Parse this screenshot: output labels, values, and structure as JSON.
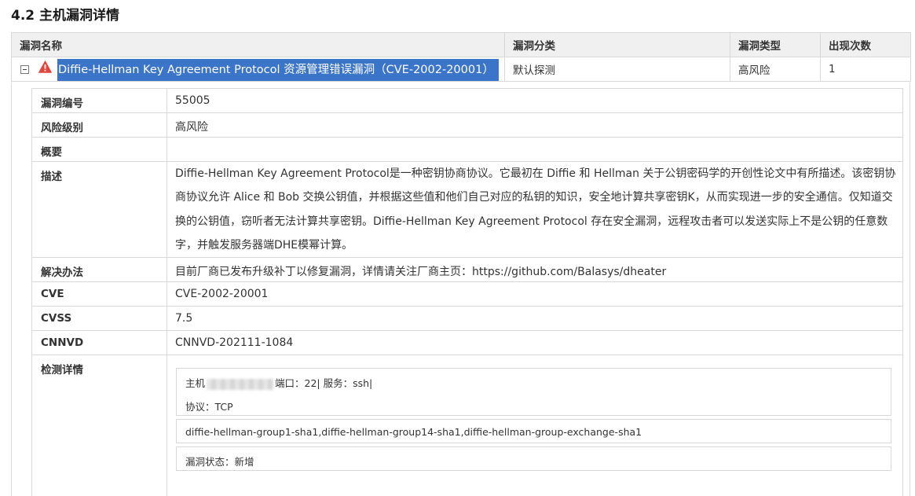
{
  "section_title": "4.2 主机漏洞详情",
  "table": {
    "headers": [
      "漏洞名称",
      "漏洞分类",
      "漏洞类型",
      "出现次数"
    ],
    "row": {
      "name": "Diffie-Hellman Key Agreement Protocol 资源管理错误漏洞（CVE-2002-20001）",
      "category": "默认探测",
      "type": "高风险",
      "count": "1"
    }
  },
  "details": {
    "id_label": "漏洞编号",
    "id": "55005",
    "risk_label": "风险级别",
    "risk": "高风险",
    "summary_label": "概要",
    "summary": "",
    "desc_label": "描述",
    "desc": "Diffie-Hellman Key Agreement Protocol是一种密钥协商协议。它最初在 Diffie 和 Hellman 关于公钥密码学的开创性论文中有所描述。该密钥协商协议允许 Alice 和 Bob 交换公钥值，并根据这些值和他们自己对应的私钥的知识，安全地计算共享密钥K，从而实现进一步的安全通信。仅知道交换的公钥值，窃听者无法计算共享密钥。Diffie-Hellman Key Agreement Protocol 存在安全漏洞，远程攻击者可以发送实际上不是公钥的任意数字，并触发服务器端DHE模幂计算。",
    "solution_label": "解决办法",
    "solution": "目前厂商已发布升级补丁以修复漏洞，详情请关注厂商主页：https://github.com/Balasys/dheater",
    "cve_label": "CVE",
    "cve": "CVE-2002-20001",
    "cvss_label": "CVSS",
    "cvss": "7.5",
    "cnnvd_label": "CNNVD",
    "cnnvd": "CNNVD-202111-1084",
    "detect_label": "检测详情",
    "detect": {
      "host_prefix": "主机",
      "port_service": "端口：22| 服务：ssh|",
      "protocol": "协议：TCP",
      "algorithms": "diffie-hellman-group1-sha1,diffie-hellman-group14-sha1,diffie-hellman-group-exchange-sha1",
      "status": "漏洞状态：新增"
    }
  },
  "colors": {
    "selection": "#3b75c9",
    "warning": "#e0463c",
    "border": "#d8d8d8",
    "header_bg": "#f0f0f0"
  }
}
